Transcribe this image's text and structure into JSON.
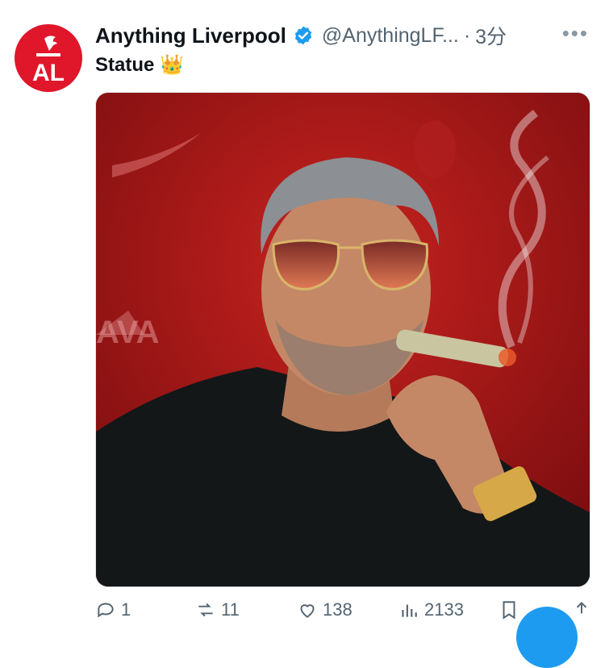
{
  "tweet": {
    "author_name": "Anything Liverpool",
    "handle": "@AnythingLF...",
    "separator": "·",
    "time": "3分",
    "more": "•••",
    "text": "Statue 👑",
    "avatar_text": "AL"
  },
  "actions": {
    "replies": "1",
    "retweets": "11",
    "likes": "138",
    "views": "2133"
  },
  "colors": {
    "brand_red": "#e0162b",
    "verified_blue": "#1d9bf0",
    "muted_text": "#536471"
  }
}
